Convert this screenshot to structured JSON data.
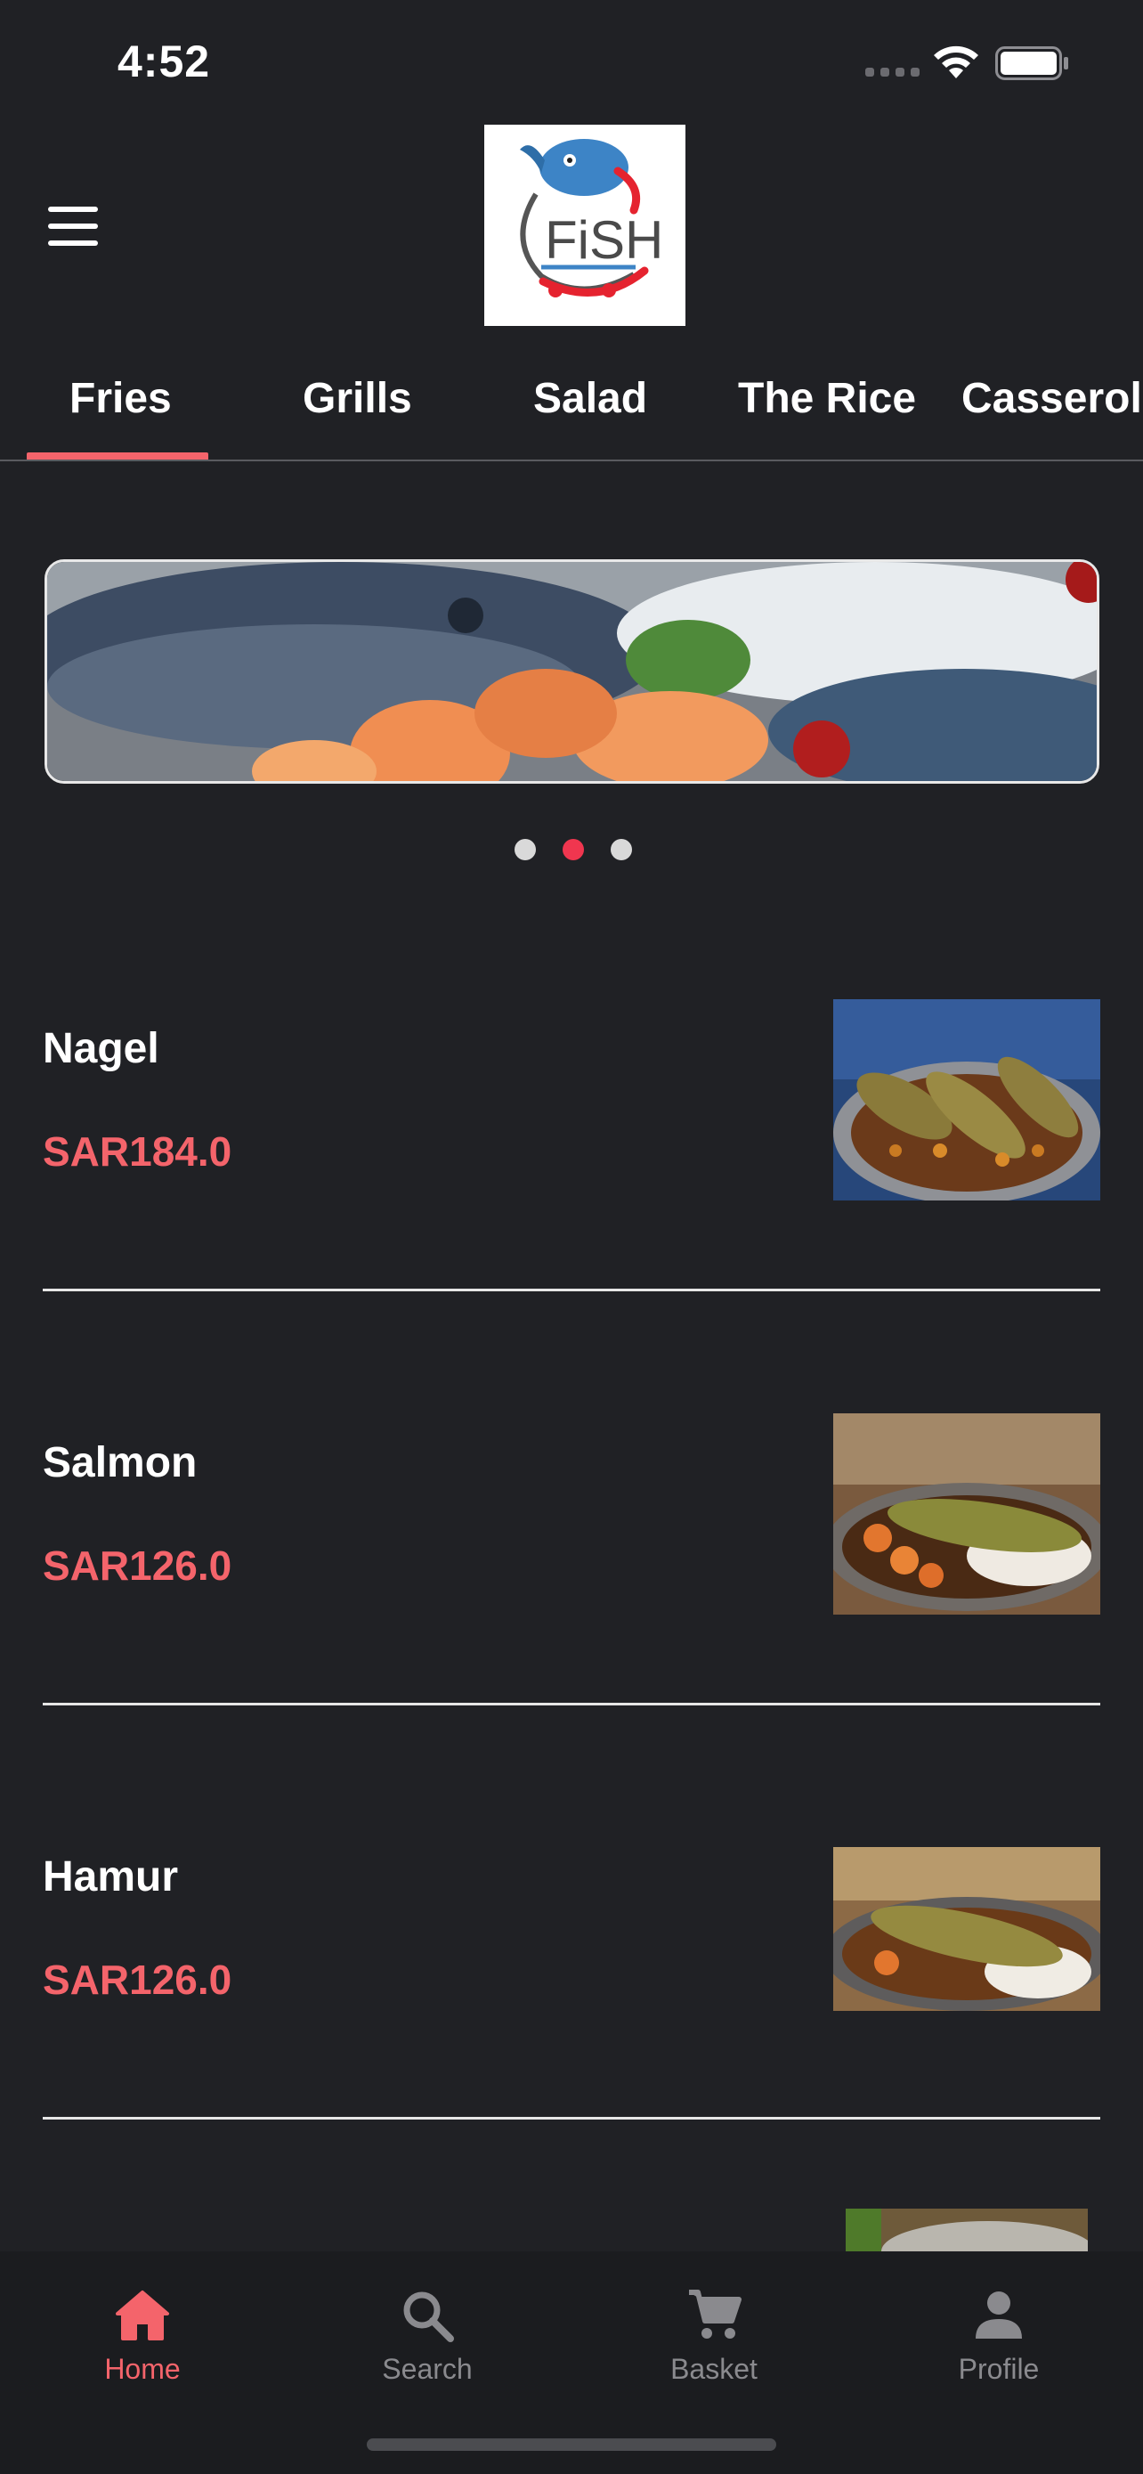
{
  "status_bar": {
    "time": "4:52"
  },
  "header": {
    "logo_text": "FiSH"
  },
  "tabs": [
    {
      "label": "Fries",
      "active": true
    },
    {
      "label": "Grills",
      "active": false
    },
    {
      "label": "Salad",
      "active": false
    },
    {
      "label": "The Rice",
      "active": false
    },
    {
      "label": "Casserole",
      "active": false
    }
  ],
  "carousel": {
    "page_count": 3,
    "active_index": 1
  },
  "menu_items": [
    {
      "name": "Nagel",
      "price": "SAR184.0"
    },
    {
      "name": "Salmon",
      "price": "SAR126.0"
    },
    {
      "name": "Hamur",
      "price": "SAR126.0"
    }
  ],
  "bottom_nav": [
    {
      "label": "Home",
      "icon": "home-icon",
      "active": true
    },
    {
      "label": "Search",
      "icon": "search-icon",
      "active": false
    },
    {
      "label": "Basket",
      "icon": "cart-icon",
      "active": false
    },
    {
      "label": "Profile",
      "icon": "person-icon",
      "active": false
    }
  ],
  "colors": {
    "background": "#202125",
    "accent": "#f4646b",
    "active_dot": "#f0364f",
    "nav_background": "#1b1c1f"
  }
}
